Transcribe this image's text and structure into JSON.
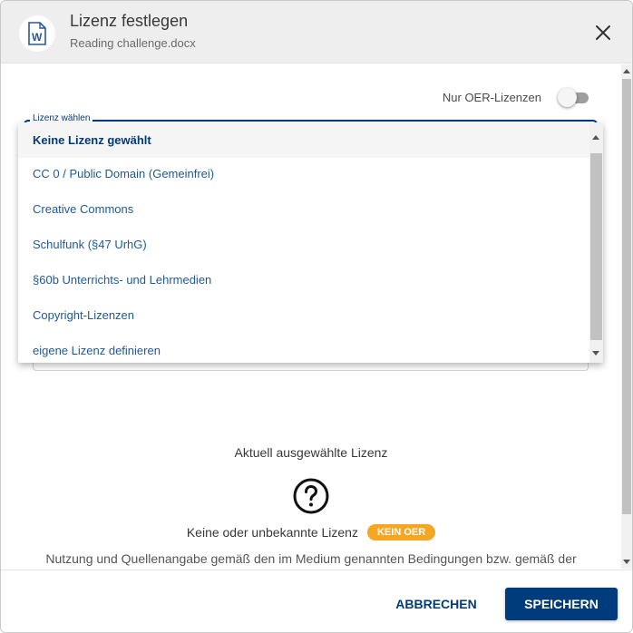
{
  "header": {
    "title": "Lizenz festlegen",
    "filename": "Reading challenge.docx",
    "file_icon": "word-document-icon"
  },
  "oer_toggle": {
    "label": "Nur OER-Lizenzen",
    "checked": false
  },
  "license_select": {
    "label": "Lizenz wählen",
    "selected": "Keine Lizenz gewählt",
    "options": [
      "Keine Lizenz gewählt",
      "CC 0 / Public Domain (Gemeinfrei)",
      "Creative Commons",
      "Schulfunk (§47 UrhG)",
      "§60b Unterrichts- und Lehrmedien",
      "Copyright-Lizenzen",
      "eigene Lizenz definieren"
    ]
  },
  "current_license": {
    "heading": "Aktuell ausgewählte Lizenz",
    "icon": "question-circle-icon",
    "name": "Keine oder unbekannte Lizenz",
    "badge": "KEIN OER",
    "usage": "Nutzung und Quellenangabe gemäß den im Medium genannten Bedingungen bzw. gemäß der"
  },
  "footer": {
    "cancel_label": "ABBRECHEN",
    "save_label": "SPEICHERN"
  },
  "colors": {
    "primary": "#003b7c",
    "link": "#1f5a96",
    "badge": "#f5a623",
    "header_bg": "#eeeeee"
  }
}
